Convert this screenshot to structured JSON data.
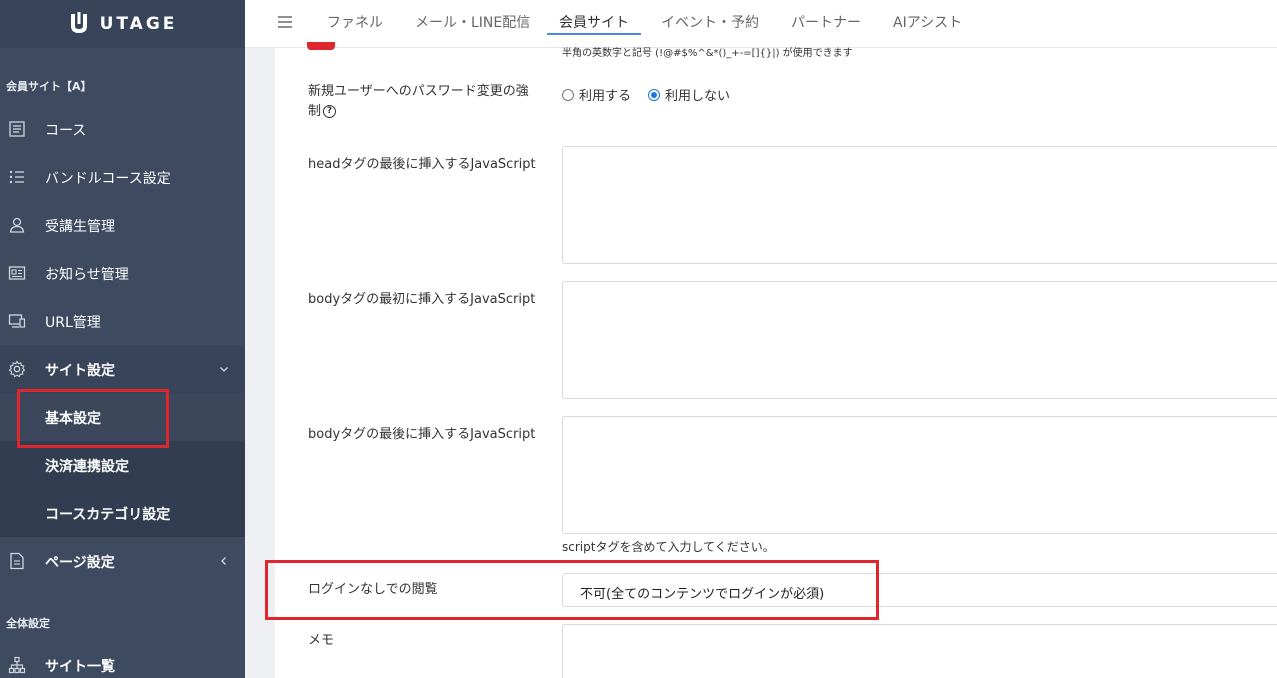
{
  "brand": {
    "name": "UTAGE"
  },
  "sidebar": {
    "section_member": "会員サイト【A】",
    "items": [
      {
        "label": "コース",
        "icon": "document-list-icon"
      },
      {
        "label": "バンドルコース設定",
        "icon": "bullet-list-icon"
      },
      {
        "label": "受講生管理",
        "icon": "user-icon"
      },
      {
        "label": "お知らせ管理",
        "icon": "newspaper-icon"
      },
      {
        "label": "URL管理",
        "icon": "devices-icon"
      },
      {
        "label": "サイト設定",
        "icon": "gear-icon"
      }
    ],
    "sub_items": [
      {
        "label": "基本設定"
      },
      {
        "label": "決済連携設定"
      },
      {
        "label": "コースカテゴリ設定"
      }
    ],
    "page_settings": {
      "label": "ページ設定",
      "icon": "page-icon"
    },
    "section_global": "全体設定",
    "site_list": {
      "label": "サイト一覧",
      "icon": "sitemap-icon"
    }
  },
  "topbar": {
    "tabs": [
      {
        "label": "ファネル"
      },
      {
        "label": "メール・LINE配信"
      },
      {
        "label": "会員サイト"
      },
      {
        "label": "イベント・予約"
      },
      {
        "label": "パートナー"
      },
      {
        "label": "AIアシスト"
      }
    ],
    "active_tab": "会員サイト"
  },
  "form": {
    "top_hint": "半角の英数字と記号 (!@#$%^&*()_+-=[]{}|) が使用できます",
    "password_force": {
      "label_line1": "新規ユーザーへのパスワード変更の強",
      "label_line2": "制",
      "option_use": "利用する",
      "option_not_use": "利用しない",
      "selected": "利用しない"
    },
    "head_js_label": "headタグの最後に挿入するJavaScript",
    "body_first_js_label": "bodyタグの最初に挿入するJavaScript",
    "body_last_js_label": "bodyタグの最後に挿入するJavaScript",
    "script_hint": "scriptタグを含めて入力してください。",
    "no_login_label": "ログインなしでの閲覧",
    "no_login_value": "不可(全てのコンテンツでログインが必須)",
    "memo_label": "メモ"
  },
  "colors": {
    "sidebar_bg": "#3d4a5f",
    "highlight_red": "#e0262d",
    "accent_blue": "#4a8be0"
  }
}
